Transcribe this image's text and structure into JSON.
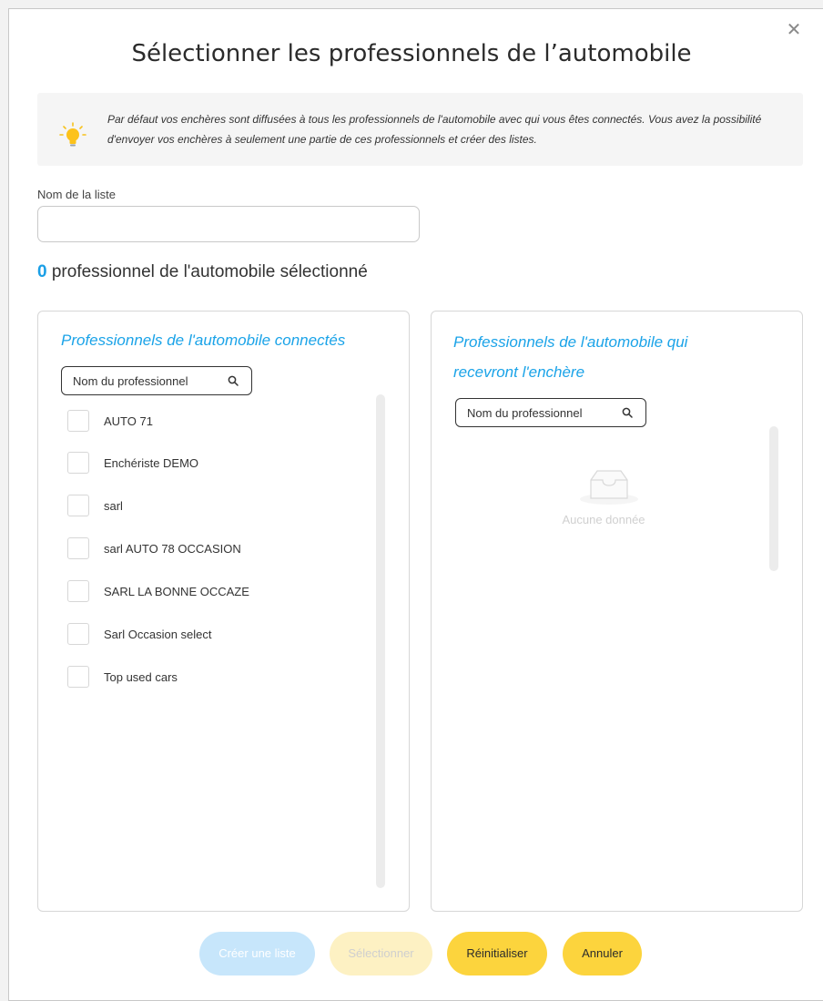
{
  "modal": {
    "title": "Sélectionner les professionnels de l’automobile",
    "close_glyph": "✕"
  },
  "info": {
    "icon": "lightbulb-icon",
    "text": "Par défaut vos enchères sont diffusées à tous les professionnels de l'automobile avec qui vous êtes connectés. Vous avez la possibilité d'envoyer vos enchères à seulement une partie de ces professionnels et créer des listes."
  },
  "list_name": {
    "label": "Nom de la liste",
    "value": "",
    "placeholder": ""
  },
  "selection_count": {
    "count": "0",
    "text": "professionnel de l'automobile sélectionné"
  },
  "left_panel": {
    "title": "Professionnels de l'automobile connectés",
    "search_placeholder": "Nom du professionnel",
    "items": [
      {
        "label": "AUTO 71",
        "checked": false
      },
      {
        "label": "Enchériste DEMO",
        "checked": false
      },
      {
        "label": "sarl",
        "checked": false
      },
      {
        "label": "sarl AUTO 78 OCCASION",
        "checked": false
      },
      {
        "label": "SARL LA BONNE OCCAZE",
        "checked": false
      },
      {
        "label": "Sarl Occasion select",
        "checked": false
      },
      {
        "label": "Top used cars",
        "checked": false
      }
    ]
  },
  "right_panel": {
    "title_line1": "Professionnels de l'automobile qui",
    "title_line2": "recevront l'enchère",
    "search_placeholder": "Nom du professionnel",
    "empty_text": "Aucune donnée"
  },
  "footer": {
    "create_list": "Créer une liste",
    "select": "Sélectionner",
    "reset": "Réinitialiser",
    "cancel": "Annuler"
  },
  "colors": {
    "accent_blue": "#1aa3e8",
    "yellow": "#fcd43d",
    "yellow_disabled": "#fdf1c3",
    "blue_disabled": "#c7e6fb"
  }
}
